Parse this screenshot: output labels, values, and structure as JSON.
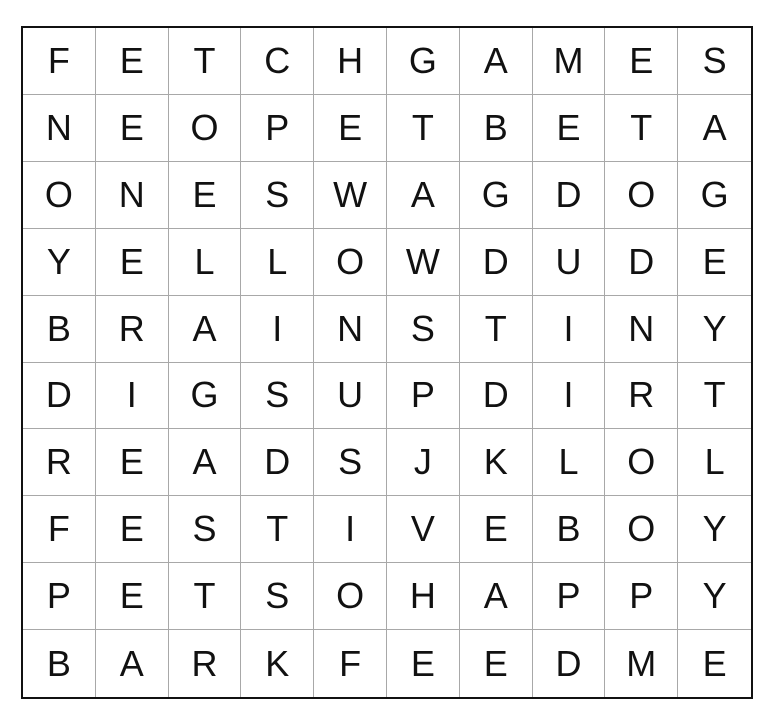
{
  "puzzle": {
    "grid": [
      [
        "F",
        "E",
        "T",
        "C",
        "H",
        "G",
        "A",
        "M",
        "E",
        "S"
      ],
      [
        "N",
        "E",
        "O",
        "P",
        "E",
        "T",
        "B",
        "E",
        "T",
        "A"
      ],
      [
        "O",
        "N",
        "E",
        "S",
        "W",
        "A",
        "G",
        "D",
        "O",
        "G"
      ],
      [
        "Y",
        "E",
        "L",
        "L",
        "O",
        "W",
        "D",
        "U",
        "D",
        "E"
      ],
      [
        "B",
        "R",
        "A",
        "I",
        "N",
        "S",
        "T",
        "I",
        "N",
        "Y"
      ],
      [
        "D",
        "I",
        "G",
        "S",
        "U",
        "P",
        "D",
        "I",
        "R",
        "T"
      ],
      [
        "R",
        "E",
        "A",
        "D",
        "S",
        "J",
        "K",
        "L",
        "O",
        "L"
      ],
      [
        "F",
        "E",
        "S",
        "T",
        "I",
        "V",
        "E",
        "B",
        "O",
        "Y"
      ],
      [
        "P",
        "E",
        "T",
        "S",
        "O",
        "H",
        "A",
        "P",
        "P",
        "Y"
      ],
      [
        "B",
        "A",
        "R",
        "K",
        "F",
        "E",
        "E",
        "D",
        "M",
        "E"
      ]
    ]
  }
}
